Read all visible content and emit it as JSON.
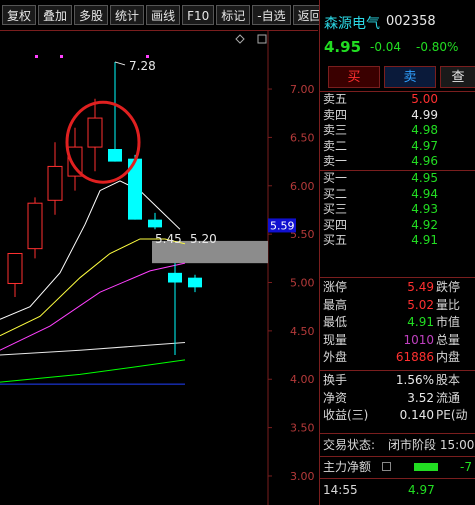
{
  "toolbar": {
    "buttons": [
      "复权",
      "叠加",
      "多股",
      "统计",
      "画线",
      "F10",
      "标记",
      "-自选",
      "返回"
    ]
  },
  "chart": {
    "price_axis": [
      "7.00",
      "6.50",
      "6.00",
      "5.50",
      "5.00",
      "4.50",
      "4.00",
      "3.50",
      "3.00"
    ],
    "high_label": "7.28",
    "ma_label_1": "5.45",
    "ma_label_2": "5.20",
    "current_price_tag": "5.59",
    "colors": {
      "up": "#ff3030",
      "down": "#00ffff",
      "ma5": "#ffffff",
      "ma10": "#ffff40",
      "ma20": "#ff40ff",
      "ma60": "#00ff00",
      "grid": "#7a1e1e"
    }
  },
  "chart_data": {
    "type": "candlestick",
    "candles": [
      {
        "open": 4.99,
        "high": 5.22,
        "low": 4.85,
        "close": 5.3,
        "dir": "up"
      },
      {
        "open": 5.35,
        "high": 5.88,
        "low": 5.25,
        "close": 5.82,
        "dir": "up"
      },
      {
        "open": 5.85,
        "high": 6.45,
        "low": 5.7,
        "close": 6.2,
        "dir": "up"
      },
      {
        "open": 6.1,
        "high": 6.6,
        "low": 5.95,
        "close": 6.4,
        "dir": "up"
      },
      {
        "open": 6.4,
        "high": 6.9,
        "low": 6.15,
        "close": 6.7,
        "dir": "up"
      },
      {
        "open": 6.38,
        "high": 7.28,
        "low": 6.25,
        "close": 6.25,
        "dir": "down"
      },
      {
        "open": 6.28,
        "high": 6.32,
        "low": 5.65,
        "close": 5.65,
        "dir": "down"
      },
      {
        "open": 5.65,
        "high": 5.72,
        "low": 5.55,
        "close": 5.57,
        "dir": "down"
      },
      {
        "open": 5.1,
        "high": 5.2,
        "low": 4.25,
        "close": 5.0,
        "dir": "down"
      },
      {
        "open": 5.05,
        "high": 5.08,
        "low": 4.9,
        "close": 4.95,
        "dir": "down"
      }
    ],
    "ylim": [
      2.7,
      7.6
    ]
  },
  "panel": {
    "name": "森源电气",
    "code": "002358",
    "price": "4.95",
    "change": "-0.04",
    "change_pct": "-0.80%",
    "buy_label": "买",
    "sell_label": "卖",
    "query_label": "查",
    "asks": [
      {
        "label": "卖五",
        "price": "5.00",
        "color": "#ff3030"
      },
      {
        "label": "卖四",
        "price": "4.99",
        "color": "#e8e8e8"
      },
      {
        "label": "卖三",
        "price": "4.98",
        "color": "#22dd22"
      },
      {
        "label": "卖二",
        "price": "4.97",
        "color": "#22dd22"
      },
      {
        "label": "卖一",
        "price": "4.96",
        "color": "#22dd22"
      }
    ],
    "bids": [
      {
        "label": "买一",
        "price": "4.95",
        "color": "#22dd22"
      },
      {
        "label": "买二",
        "price": "4.94",
        "color": "#22dd22"
      },
      {
        "label": "买三",
        "price": "4.93",
        "color": "#22dd22"
      },
      {
        "label": "买四",
        "price": "4.92",
        "color": "#22dd22"
      },
      {
        "label": "买五",
        "price": "4.91",
        "color": "#22dd22"
      }
    ],
    "stats": [
      {
        "label": "涨停",
        "value": "5.49",
        "color": "#ff3030",
        "right": "跌停"
      },
      {
        "label": "最高",
        "value": "5.02",
        "color": "#ff3030",
        "right": "量比"
      },
      {
        "label": "最低",
        "value": "4.91",
        "color": "#22dd22",
        "right": "市值"
      },
      {
        "label": "现量",
        "value": "1010",
        "color": "#c040c0",
        "right": "总量"
      },
      {
        "label": "外盘",
        "value": "61886",
        "color": "#ff3030",
        "right": "内盘"
      }
    ],
    "stats2": [
      {
        "label": "换手",
        "value": "1.56%",
        "color": "#e8e8e8",
        "right": "股本"
      },
      {
        "label": "净资",
        "value": "3.52",
        "color": "#e8e8e8",
        "right": "流通"
      },
      {
        "label": "收益(三)",
        "value": "0.140",
        "color": "#e8e8e8",
        "right": "PE(动"
      }
    ],
    "trade_status_label": "交易状态:",
    "trade_status_value": "闭市阶段 15:00",
    "main_flow_label": "主力净额",
    "main_flow_value": "-7",
    "ticks": [
      {
        "time": "14:55",
        "price": "4.97"
      }
    ]
  }
}
